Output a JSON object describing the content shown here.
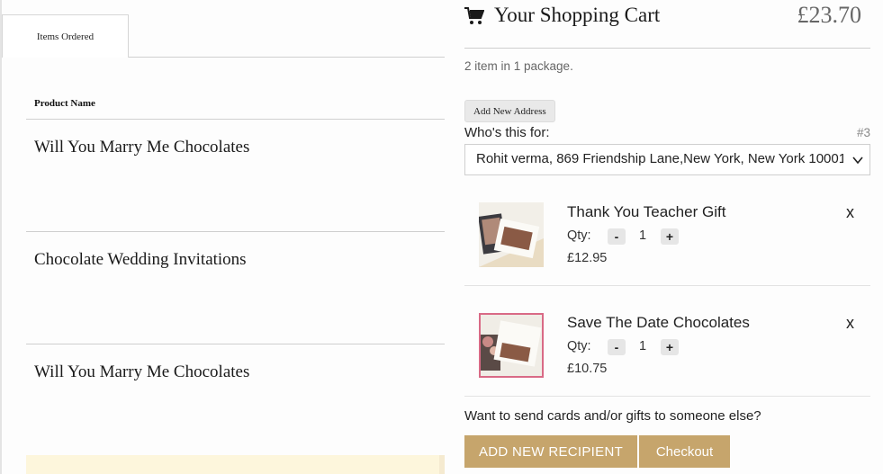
{
  "orders_panel": {
    "tab_label": "Items Ordered",
    "column_header": "Product Name",
    "products": [
      {
        "name": "Will You Marry Me Chocolates"
      },
      {
        "name": "Chocolate Wedding Invitations"
      },
      {
        "name": "Will You Marry Me Chocolates"
      }
    ]
  },
  "cart": {
    "icon": "shopping-cart-icon",
    "title": "Your Shopping Cart",
    "total": "£23.70",
    "summary": "2 item in 1 package.",
    "add_address_label": "Add New Address",
    "recipient_label": "Who's this for:",
    "recipient_number": "#3",
    "recipient_selected": "Rohit verma, 869 Friendship Lane,New York, New York 10001",
    "qty_label": "Qty:",
    "minus_label": "-",
    "plus_label": "+",
    "remove_label": "x",
    "items": [
      {
        "name": "Thank You Teacher Gift",
        "qty": "1",
        "price": "£12.95"
      },
      {
        "name": "Save The Date Chocolates",
        "qty": "1",
        "price": "£10.75"
      }
    ],
    "gift_question": "Want to send cards and/or gifts to someone else?",
    "add_recipient_label": "ADD NEW RECIPIENT",
    "checkout_label": "Checkout"
  },
  "colors": {
    "accent": "#c6a56c",
    "cream_strip": "#fdf6dc",
    "thumb_border_pink": "#d96a86"
  }
}
